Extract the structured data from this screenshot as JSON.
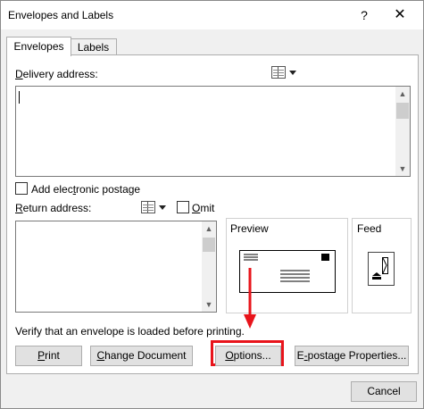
{
  "window": {
    "title": "Envelopes and Labels",
    "help_glyph": "?",
    "close_glyph": "✕"
  },
  "tabs": [
    {
      "label": "Envelopes",
      "active": true
    },
    {
      "label": "Labels",
      "active": false
    }
  ],
  "delivery": {
    "label_pre": "",
    "label_ul": "D",
    "label_post": "elivery address:",
    "value": ""
  },
  "postage": {
    "label_pre": "Add elec",
    "label_ul": "t",
    "label_post": "ronic postage",
    "checked": false
  },
  "return": {
    "label_pre": "",
    "label_ul": "R",
    "label_post": "eturn address:",
    "value": "",
    "omit_pre": "",
    "omit_ul": "O",
    "omit_post": "mit",
    "omit_checked": false
  },
  "preview": {
    "title": "Preview"
  },
  "feed": {
    "title": "Feed"
  },
  "verify_text": "Verify that an envelope is loaded before printing.",
  "buttons": {
    "print": {
      "pre": "",
      "ul": "P",
      "post": "rint"
    },
    "change_document": {
      "pre": "",
      "ul": "C",
      "post": "hange Document"
    },
    "options": {
      "pre": "",
      "ul": "O",
      "post": "ptions..."
    },
    "epostage": {
      "pre": "E",
      "ul": "-",
      "post": "postage Properties..."
    },
    "cancel": "Cancel"
  },
  "colors": {
    "highlight": "#e8141b",
    "button_bg": "#e1e1e1",
    "dialog_bg": "#f0f0f0"
  },
  "icons": {
    "address_book": "address-book-icon",
    "dropdown": "chevron-down-icon"
  }
}
